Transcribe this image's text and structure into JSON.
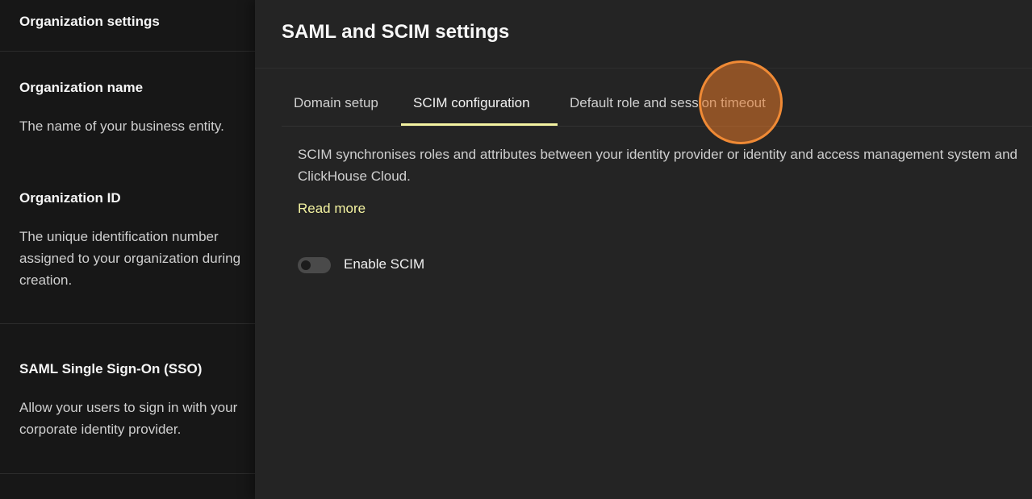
{
  "left_panel": {
    "header": "Organization settings",
    "sections": [
      {
        "title": "Organization name",
        "description": "The name of your business entity."
      },
      {
        "title": "Organization ID",
        "description": "The unique identification number assigned to your organization during creation."
      },
      {
        "title": "SAML Single Sign-On (SSO)",
        "description": "Allow your users to sign in with your corporate identity provider."
      }
    ]
  },
  "panel": {
    "title": "SAML and SCIM settings",
    "tabs": [
      {
        "label": "Domain setup",
        "active": false
      },
      {
        "label": "SCIM configuration",
        "active": true
      },
      {
        "label": "Default role and session timeout",
        "active": false
      }
    ],
    "description": "SCIM synchronises roles and attributes between your identity provider or identity and access management system and ClickHouse Cloud.",
    "read_more": "Read more",
    "toggle": {
      "label": "Enable SCIM",
      "enabled": false
    }
  },
  "colors": {
    "accent": "#f4f3a1",
    "click_indicator": "#f08a35",
    "panel_bg": "#242424",
    "sidebar_bg": "#171717"
  }
}
